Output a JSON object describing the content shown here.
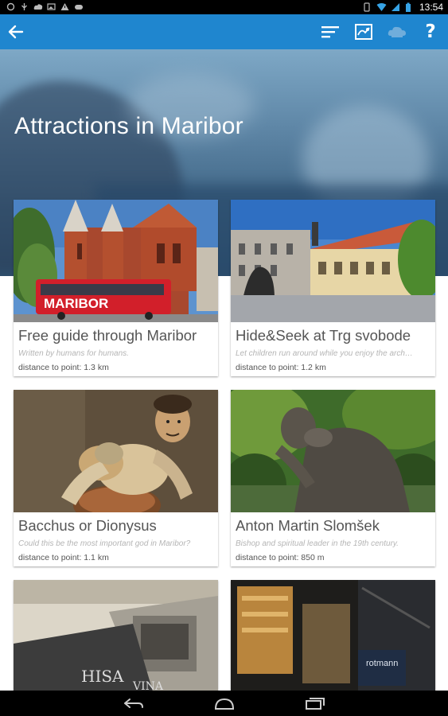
{
  "status_bar": {
    "time": "13:54",
    "left_icons": [
      "notification-icon",
      "usb-icon",
      "cloud-icon",
      "image-icon",
      "warning-icon",
      "game-icon"
    ],
    "right_icons": [
      "vibrate-icon",
      "wifi-icon",
      "signal-icon",
      "battery-icon"
    ]
  },
  "action_bar": {
    "color": "#1f86cf",
    "back_icon": "arrow-left-icon",
    "actions": [
      "filter-sort-icon",
      "map-icon",
      "cloud-sync-icon",
      "help-icon"
    ],
    "help_label": "?"
  },
  "header": {
    "title": "Attractions in Maribor"
  },
  "attractions": [
    {
      "title": "Free guide through Maribor",
      "subtitle": "Written by humans for humans.",
      "distance": "distance to point: 1.3 km"
    },
    {
      "title": "Hide&Seek at Trg svobode",
      "subtitle": "Let children run around while you enjoy the arch…",
      "distance": "distance to point: 1.2 km"
    },
    {
      "title": "Bacchus or Dionysus",
      "subtitle": "Could this be the most important god in Maribor?",
      "distance": "distance to point: 1.1 km"
    },
    {
      "title": "Anton Martin Slomšek",
      "subtitle": "Bishop and spiritual leader in the 19th century.",
      "distance": "distance to point: 850 m"
    },
    {
      "sign_text": "HISA",
      "sign_text_2": "VINA"
    },
    {
      "sign_text": "rotmann"
    }
  ],
  "images": {
    "0": {
      "bus_text": "MARIBOR"
    }
  },
  "nav_bar": {
    "buttons": [
      "back-nav-icon",
      "home-nav-icon",
      "recents-nav-icon"
    ]
  }
}
